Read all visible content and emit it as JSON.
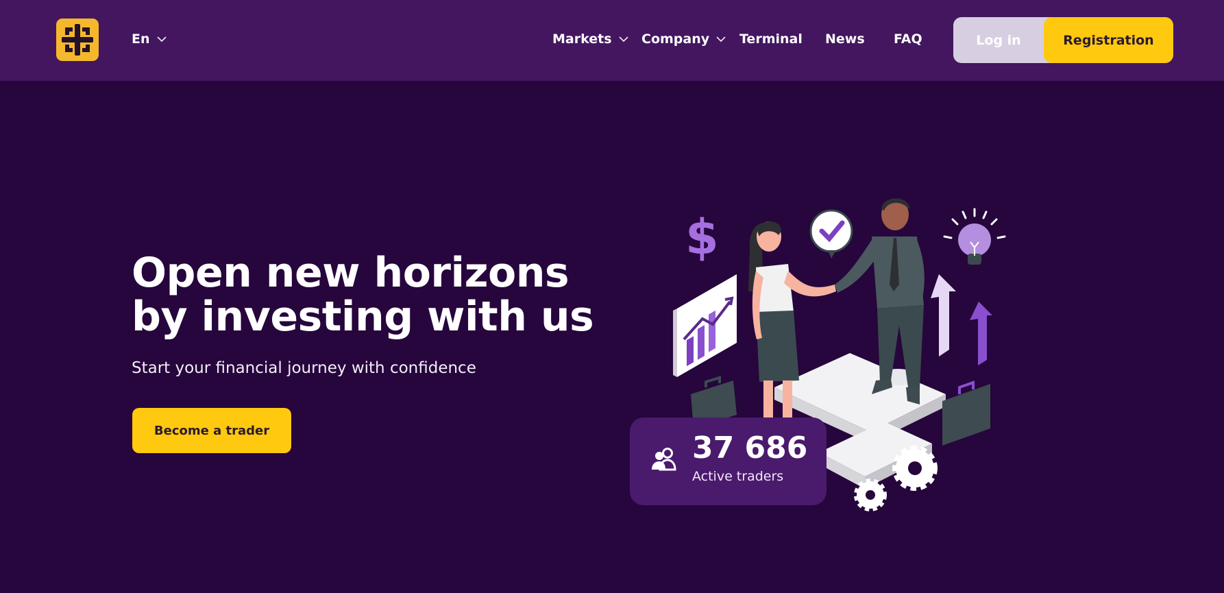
{
  "header": {
    "language": "En",
    "nav": [
      {
        "label": "Markets",
        "has_dropdown": true
      },
      {
        "label": "Company",
        "has_dropdown": true
      },
      {
        "label": "Terminal",
        "has_dropdown": false
      },
      {
        "label": "News",
        "has_dropdown": false
      },
      {
        "label": "FAQ",
        "has_dropdown": false
      }
    ],
    "login_label": "Log in",
    "register_label": "Registration"
  },
  "hero": {
    "title_line1": "Open new horizons",
    "title_line2": "by investing with us",
    "subtitle": "Start your financial journey with confidence",
    "cta_label": "Become a trader"
  },
  "stats": {
    "value": "37 686",
    "label": "Active traders",
    "icon": "users-icon"
  },
  "icons": {
    "logo": "brand-logo-icon",
    "chevron": "chevron-down-icon"
  },
  "colors": {
    "page_background": "#26063c",
    "header_background": "#43165f",
    "accent_yellow": "#ffc90f",
    "logo_yellow": "#f5b82c",
    "card_purple": "#4a1a6d",
    "login_background": "#d7cfe1"
  }
}
